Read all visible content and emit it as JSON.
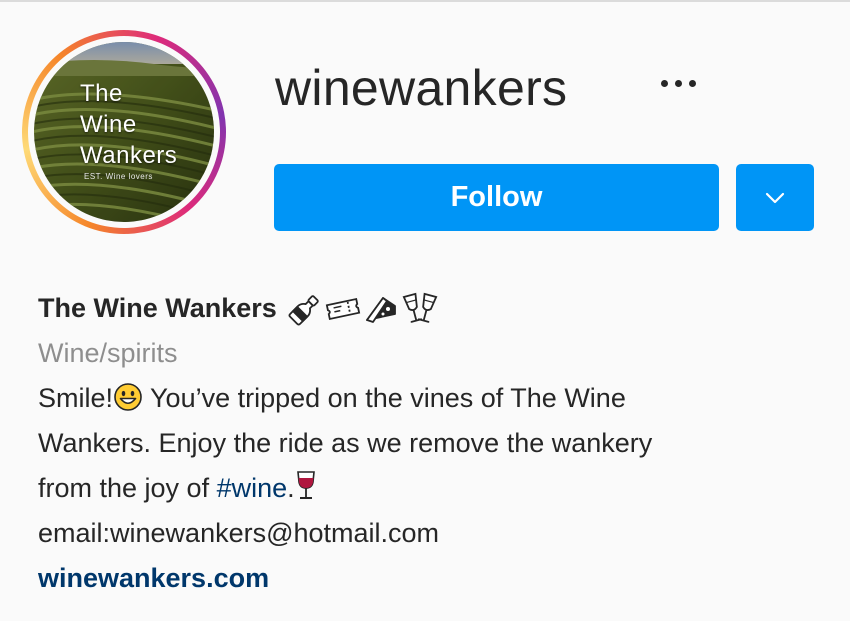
{
  "profile": {
    "username": "winewankers",
    "avatar_text_lines": [
      "The",
      "Wine",
      "Wankers"
    ],
    "avatar_subtext": "EST. Wine lovers",
    "follow_label": "Follow",
    "more_icon": "more-horizontal-icon",
    "dropdown_icon": "chevron-down-icon",
    "full_name": "The Wine Wankers",
    "name_emojis": [
      "champagne-bottle-icon",
      "ticket-icon",
      "cheese-wedge-icon",
      "clinking-glasses-icon"
    ],
    "category": "Wine/spirits",
    "bio": {
      "intro": "Smile!",
      "line1_rest": " You’ve tripped on the vines of The Wine",
      "line2": "Wankers. Enjoy the ride as we remove the wankery",
      "line3_prefix": "from the joy of ",
      "hashtag": "#wine",
      "line3_suffix": ".",
      "email": "email:winewankers@hotmail.com"
    },
    "website": "winewankers.com"
  },
  "colors": {
    "accent": "#0095f6",
    "link": "#00376b",
    "muted": "#8e8e8e",
    "text": "#262626",
    "background": "#fafafa"
  }
}
